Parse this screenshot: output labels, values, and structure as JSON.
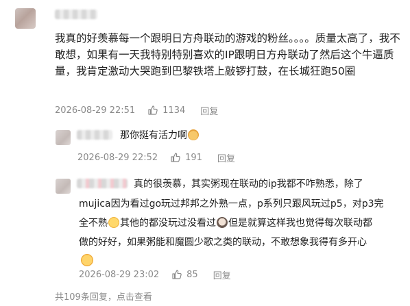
{
  "main_comment": {
    "text": "我真的好羡慕每一个跟明日方舟联动的游戏的粉丝。。。。质量太高了，我不敢想，如果有一天我特别特别喜欢的IP跟明日方舟联动了然后这个牛逼质量，我肯定激动大哭跑到巴黎铁塔上敲锣打鼓，在长城狂跑50圈",
    "timestamp": "2026-08-29 22:51",
    "likes": "1134",
    "reply_label": "回复"
  },
  "reply1": {
    "text": "那你挺有活力啊",
    "emoji": "fox-emoji",
    "timestamp": "2026-08-29 22:52",
    "likes": "191",
    "reply_label": "回复"
  },
  "reply2": {
    "line1": "真的很羡慕，其实粥现在联动的ip我都不咋熟悉，除了",
    "line2": "mujica因为看过go玩过邦邦之外熟一点，p系列只跟风玩过p5，对p3完",
    "line3a": "全不熟",
    "line3b": "其他的都没玩过没看过",
    "line3c": "但是就算这样我也觉得每次联动都",
    "line4": "做的好好，如果粥能和魔圆少歌之类的联动，不敢想象我得有多开心",
    "timestamp": "2026-08-29 23:02",
    "likes": "85",
    "reply_label": "回复"
  },
  "footer": {
    "count_text": "共109条回复",
    "separator": "，",
    "collapse_label": "点击查看"
  },
  "colors": {
    "meta_gray": "#8a8a8a",
    "text_dark": "#222222"
  }
}
